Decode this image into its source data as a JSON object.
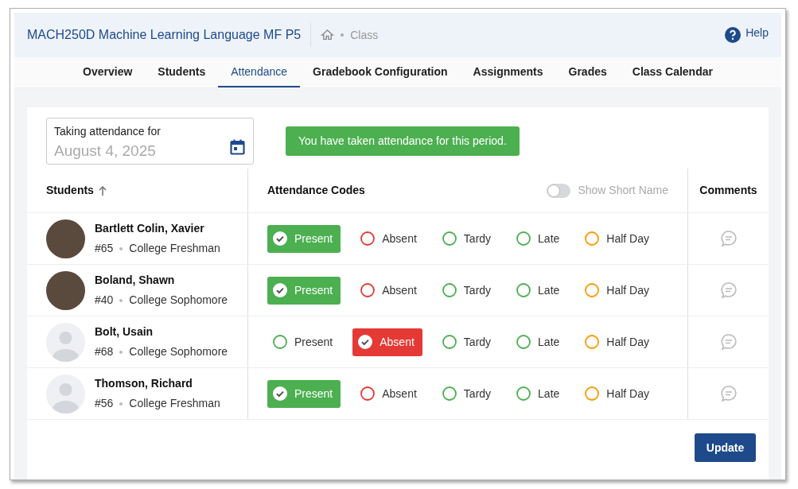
{
  "header": {
    "course_title": "MACH250D Machine Learning Language MF P5",
    "breadcrumb": "Class",
    "help": "Help"
  },
  "tabs": [
    {
      "label": "Overview",
      "selected": false
    },
    {
      "label": "Students",
      "selected": false
    },
    {
      "label": "Attendance",
      "selected": true
    },
    {
      "label": "Gradebook Configuration",
      "selected": false
    },
    {
      "label": "Assignments",
      "selected": false
    },
    {
      "label": "Grades",
      "selected": false
    },
    {
      "label": "Class Calendar",
      "selected": false
    }
  ],
  "date_field": {
    "label": "Taking attendance for",
    "placeholder": "August 4, 2025"
  },
  "notice": "You have taken attendance for this period.",
  "table": {
    "columns": {
      "students": "Students",
      "codes": "Attendance Codes",
      "comments": "Comments"
    },
    "short_name_toggle": {
      "label": "Show Short Name",
      "on": false
    },
    "rows": [
      {
        "name": "Bartlett Colin, Xavier",
        "number": "#65",
        "year": "College Freshman",
        "kind": "photo",
        "codes": [
          {
            "label": "Present",
            "color": "#4caf50",
            "selected": true
          },
          {
            "label": "Absent",
            "color": "#e53935",
            "selected": false
          },
          {
            "label": "Tardy",
            "color": "#4caf50",
            "selected": false
          },
          {
            "label": "Late",
            "color": "#4caf50",
            "selected": false
          },
          {
            "label": "Half Day",
            "color": "#ff9800",
            "selected": false
          }
        ]
      },
      {
        "name": "Boland, Shawn",
        "number": "#40",
        "year": "College Sophomore",
        "kind": "photo",
        "codes": [
          {
            "label": "Present",
            "color": "#4caf50",
            "selected": true
          },
          {
            "label": "Absent",
            "color": "#e53935",
            "selected": false
          },
          {
            "label": "Tardy",
            "color": "#4caf50",
            "selected": false
          },
          {
            "label": "Late",
            "color": "#4caf50",
            "selected": false
          },
          {
            "label": "Half Day",
            "color": "#ff9800",
            "selected": false
          }
        ]
      },
      {
        "name": "Bolt, Usain",
        "number": "#68",
        "year": "College Sophomore",
        "kind": "silhouette",
        "codes": [
          {
            "label": "Present",
            "color": "#4caf50",
            "selected": false
          },
          {
            "label": "Absent",
            "color": "#e53935",
            "selected": true
          },
          {
            "label": "Tardy",
            "color": "#4caf50",
            "selected": false
          },
          {
            "label": "Late",
            "color": "#4caf50",
            "selected": false
          },
          {
            "label": "Half Day",
            "color": "#ff9800",
            "selected": false
          }
        ]
      },
      {
        "name": "Thomson, Richard",
        "number": "#56",
        "year": "College Freshman",
        "kind": "silhouette",
        "codes": [
          {
            "label": "Present",
            "color": "#4caf50",
            "selected": true
          },
          {
            "label": "Absent",
            "color": "#e53935",
            "selected": false
          },
          {
            "label": "Tardy",
            "color": "#4caf50",
            "selected": false
          },
          {
            "label": "Late",
            "color": "#4caf50",
            "selected": false
          },
          {
            "label": "Half Day",
            "color": "#ff9800",
            "selected": false
          }
        ]
      }
    ]
  },
  "update_button": "Update"
}
